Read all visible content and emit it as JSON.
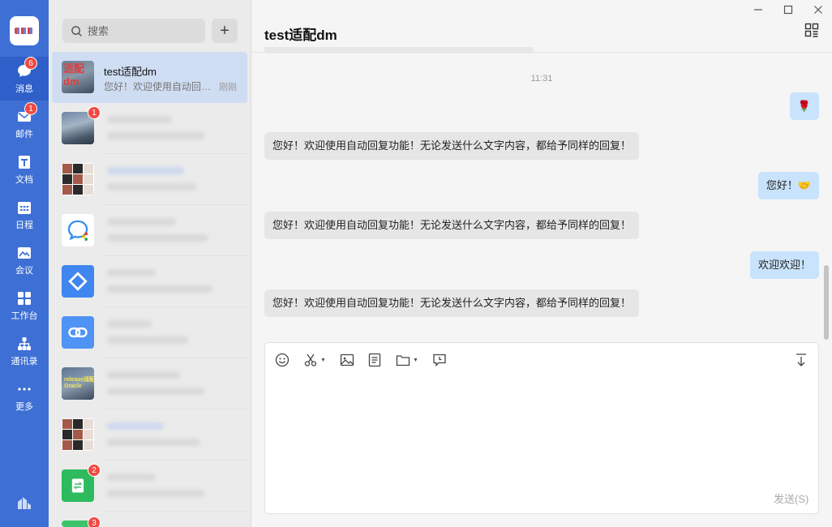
{
  "rail": {
    "items": [
      {
        "label": "消息",
        "icon": "message-icon",
        "badge": "6"
      },
      {
        "label": "邮件",
        "icon": "mail-icon",
        "badge": "1"
      },
      {
        "label": "文档",
        "icon": "document-icon",
        "badge": ""
      },
      {
        "label": "日程",
        "icon": "calendar-icon",
        "badge": ""
      },
      {
        "label": "会议",
        "icon": "meeting-icon",
        "badge": ""
      },
      {
        "label": "工作台",
        "icon": "workbench-icon",
        "badge": ""
      },
      {
        "label": "通讯录",
        "icon": "contacts-icon",
        "badge": ""
      },
      {
        "label": "更多",
        "icon": "more-icon",
        "badge": ""
      }
    ]
  },
  "list": {
    "search_placeholder": "搜索",
    "add_label": "+",
    "conversations": [
      {
        "name": "test适配dm",
        "preview": "您好！欢迎使用自动回复功能！无论发送什么文字内容，都给予同样的回复！",
        "time": "刚刚",
        "badge": "",
        "avatar_text": "适配\ndm"
      },
      {
        "name": "",
        "preview": "",
        "time": "",
        "badge": "1"
      },
      {
        "name": "",
        "preview": "",
        "time": "",
        "badge": ""
      },
      {
        "name": "",
        "preview": "",
        "time": "",
        "badge": ""
      },
      {
        "name": "",
        "preview": "",
        "time": "",
        "badge": ""
      },
      {
        "name": "",
        "preview": "",
        "time": "",
        "badge": ""
      },
      {
        "name": "",
        "preview": "",
        "time": "",
        "badge": "",
        "avatar_text": "release适配 Oracle"
      },
      {
        "name": "",
        "preview": "",
        "time": "",
        "badge": ""
      },
      {
        "name": "",
        "preview": "",
        "time": "",
        "badge": "2"
      },
      {
        "name": "",
        "preview": "",
        "time": "",
        "badge": "3"
      }
    ]
  },
  "chat": {
    "title": "test适配dm",
    "timestamp": "11:31",
    "messages": [
      {
        "dir": "out",
        "text": "🌹"
      },
      {
        "dir": "in",
        "text": "您好！欢迎使用自动回复功能！无论发送什么文字内容，都给予同样的回复！"
      },
      {
        "dir": "out",
        "text": "您好！🤝"
      },
      {
        "dir": "in",
        "text": "您好！欢迎使用自动回复功能！无论发送什么文字内容，都给予同样的回复！"
      },
      {
        "dir": "out",
        "text": "欢迎欢迎！"
      },
      {
        "dir": "in",
        "text": "您好！欢迎使用自动回复功能！无论发送什么文字内容，都给予同样的回复！"
      }
    ]
  },
  "composer": {
    "send_label": "发送(S)",
    "tools": [
      "emoji-icon",
      "scissors-icon",
      "image-icon",
      "document-icon",
      "folder-icon",
      "screen-record-icon",
      "collapse-icon"
    ]
  },
  "colors": {
    "rail": "#3e6fd4",
    "bubble_out": "#c8e3fb",
    "bubble_in": "#e6e6e6",
    "badge": "#f04a43"
  }
}
